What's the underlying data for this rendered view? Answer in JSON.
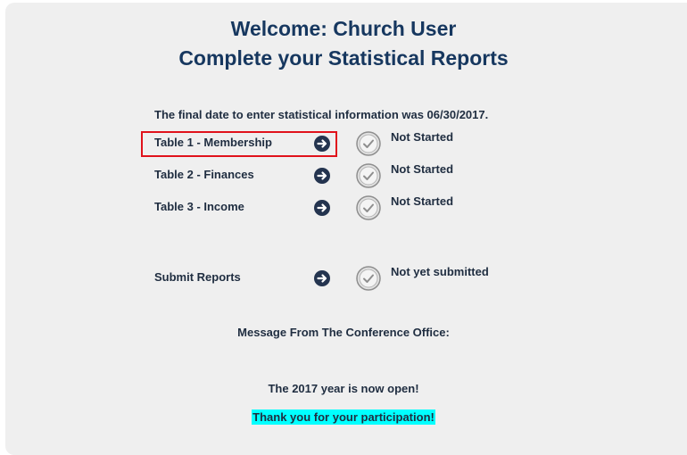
{
  "header": {
    "welcome": "Welcome: Church User",
    "subtitle": "Complete your Statistical Reports"
  },
  "final_date_text": "The final date to enter statistical information was 06/30/2017.",
  "tables": [
    {
      "label": "Table 1 - Membership",
      "status": "Not Started"
    },
    {
      "label": "Table 2 - Finances",
      "status": "Not Started"
    },
    {
      "label": "Table 3 - Income",
      "status": "Not Started"
    }
  ],
  "submit": {
    "label": "Submit Reports",
    "status": "Not yet submitted"
  },
  "message": {
    "heading": "Message From The Conference Office:",
    "body": "The 2017 year is now open!",
    "thanks": "Thank you for your participation!"
  },
  "colors": {
    "title": "#16375f",
    "text": "#1f2d40",
    "arrow_bg": "#24344f",
    "highlight_border": "#e0121b",
    "thanks_bg": "#00ffff",
    "panel_bg": "#efefef"
  },
  "icons": {
    "arrow": "arrow-right-circle-icon",
    "status": "check-circle-icon"
  }
}
